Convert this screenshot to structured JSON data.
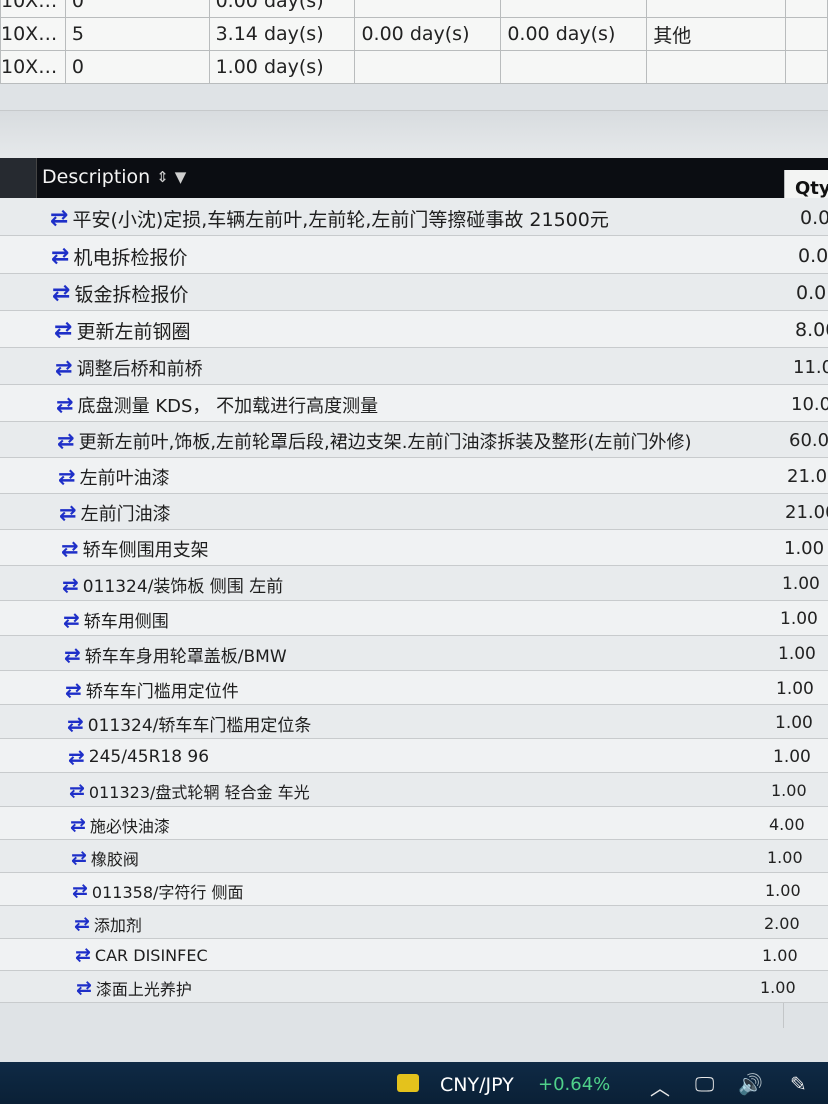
{
  "top_table": {
    "rows": [
      {
        "id": "10X…",
        "qty": "0",
        "d1": "0.00 day(s)",
        "d2": "",
        "d3": "",
        "type": ""
      },
      {
        "id": "10X…",
        "qty": "5",
        "d1": "3.14 day(s)",
        "d2": "0.00 day(s)",
        "d3": "0.00 day(s)",
        "type": "其他"
      },
      {
        "id": "10X…",
        "qty": "0",
        "d1": "1.00 day(s)",
        "d2": "",
        "d3": "",
        "type": ""
      }
    ]
  },
  "grid": {
    "header": {
      "description": "Description",
      "qty": "Qty",
      "sort_icon": "sort-icon",
      "filter_icon": "filter-icon"
    },
    "rows": [
      {
        "desc": "平安(小沈)定损,车辆左前叶,左前轮,左前门等擦碰事故 21500元",
        "qty": "0.0"
      },
      {
        "desc": "机电拆检报价",
        "qty": "0.0"
      },
      {
        "desc": "钣金拆检报价",
        "qty": "0.0"
      },
      {
        "desc": "更新左前钢圈",
        "qty": "8.00"
      },
      {
        "desc": "调整后桥和前桥",
        "qty": "11.0"
      },
      {
        "desc": "底盘测量 KDS， 不加载进行高度测量",
        "qty": "10.0"
      },
      {
        "desc": "更新左前叶,饰板,左前轮罩后段,裙边支架.左前门油漆拆装及整形(左前门外修)",
        "qty": "60.0"
      },
      {
        "desc": "左前叶油漆",
        "qty": "21.00"
      },
      {
        "desc": "左前门油漆",
        "qty": "21.00"
      },
      {
        "desc": "轿车侧围用支架",
        "qty": "1.00"
      },
      {
        "desc": "011324/装饰板 侧围 左前",
        "qty": "1.00"
      },
      {
        "desc": "轿车用侧围",
        "qty": "1.00"
      },
      {
        "desc": "轿车车身用轮罩盖板/BMW",
        "qty": "1.00"
      },
      {
        "desc": "轿车车门槛用定位件",
        "qty": "1.00"
      },
      {
        "desc": "011324/轿车车门槛用定位条",
        "qty": "1.00"
      },
      {
        "desc": "245/45R18 96",
        "qty": "1.00"
      },
      {
        "desc": "011323/盘式轮辋 轻合金 车光",
        "qty": "1.00"
      },
      {
        "desc": "施必快油漆",
        "qty": "4.00"
      },
      {
        "desc": "橡胶阀",
        "qty": "1.00"
      },
      {
        "desc": "011358/字符行 侧面",
        "qty": "1.00"
      },
      {
        "desc": "添加剂",
        "qty": "2.00"
      },
      {
        "desc": "CAR DISINFEC",
        "qty": "1.00"
      },
      {
        "desc": "漆面上光养护",
        "qty": "1.00"
      }
    ]
  },
  "taskbar": {
    "ticker": "CNY/JPY",
    "change": "+0.64%",
    "change_color": "#4fd18a",
    "coin_icon": "coin-icon",
    "chevron_icon": "chevron-up-icon",
    "network_icon": "network-icon",
    "volume_icon": "volume-icon",
    "pen_icon": "pen-icon"
  }
}
